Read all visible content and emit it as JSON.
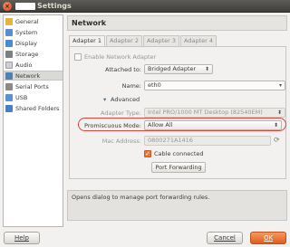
{
  "window": {
    "title": "Settings",
    "close_glyph": "×"
  },
  "sidebar": {
    "items": [
      {
        "label": "General",
        "icon": "general-icon",
        "color": "#e4b441"
      },
      {
        "label": "System",
        "icon": "system-icon",
        "color": "#5c8ccf"
      },
      {
        "label": "Display",
        "icon": "display-icon",
        "color": "#4a8ad1"
      },
      {
        "label": "Storage",
        "icon": "storage-icon",
        "color": "#7b7f86"
      },
      {
        "label": "Audio",
        "icon": "audio-icon",
        "color": "#cfd1d4"
      },
      {
        "label": "Network",
        "icon": "network-icon",
        "color": "#4f7fb5",
        "selected": true
      },
      {
        "label": "Serial Ports",
        "icon": "serial-ports-icon",
        "color": "#8a8a8a"
      },
      {
        "label": "USB",
        "icon": "usb-icon",
        "color": "#5a90d6"
      },
      {
        "label": "Shared Folders",
        "icon": "shared-folders-icon",
        "color": "#4a7ec4"
      }
    ]
  },
  "main": {
    "title": "Network",
    "tabs": [
      {
        "label": "Adapter 1",
        "active": true
      },
      {
        "label": "Adapter 2",
        "active": false
      },
      {
        "label": "Adapter 3",
        "active": false
      },
      {
        "label": "Adapter 4",
        "active": false
      }
    ],
    "enable_adapter_label": "Enable Network Adapter",
    "attached_to_label": "Attached to:",
    "attached_to_value": "Bridged Adapter",
    "name_label": "Name:",
    "name_value": "eth0",
    "advanced_label": "Advanced",
    "adapter_type_label": "Adapter Type:",
    "adapter_type_value": "Intel PRO/1000 MT Desktop (82540EM)",
    "promiscuous_label": "Promiscuous Mode:",
    "promiscuous_value": "Allow All",
    "mac_label": "Mac Address:",
    "mac_value": "0800271A1416",
    "cable_label": "Cable connected",
    "port_forwarding_label": "Port Forwarding"
  },
  "status": {
    "text": "Opens dialog to manage port forwarding rules."
  },
  "footer": {
    "help": "Help",
    "cancel": "Cancel",
    "ok": "OK"
  },
  "colors": {
    "accent": "#e05e1d",
    "highlight": "#d8473a"
  }
}
